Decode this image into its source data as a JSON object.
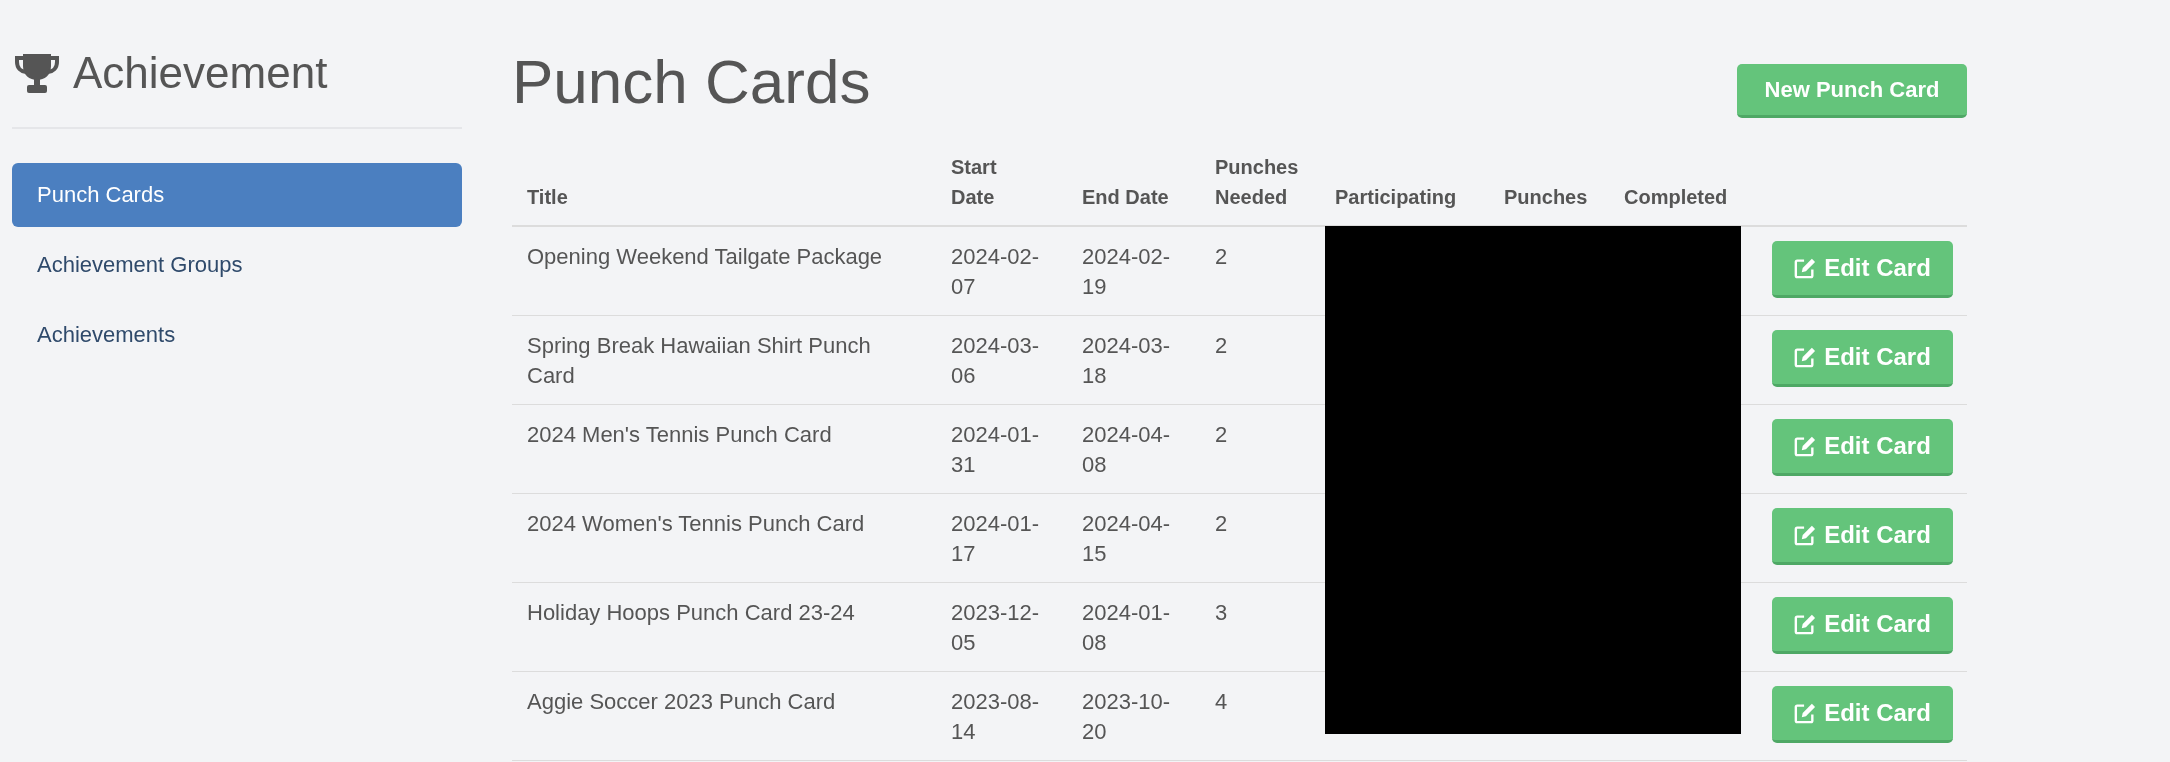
{
  "sidebar": {
    "title": "Achievement",
    "items": [
      {
        "label": "Punch Cards",
        "selected": true
      },
      {
        "label": "Achievement Groups",
        "selected": false
      },
      {
        "label": "Achievements",
        "selected": false
      }
    ]
  },
  "page": {
    "title": "Punch Cards",
    "new_button": "New Punch Card"
  },
  "table": {
    "columns": [
      "Title",
      "Start Date",
      "End Date",
      "Punches Needed",
      "Participating",
      "Punches",
      "Completed"
    ],
    "redacted": true,
    "rows": [
      {
        "title": "Opening Weekend Tailgate Package",
        "start_date": "2024-02-07",
        "end_date": "2024-02-19",
        "punches_needed": "2",
        "action": "Edit Card"
      },
      {
        "title": "Spring Break Hawaiian Shirt Punch Card",
        "start_date": "2024-03-06",
        "end_date": "2024-03-18",
        "punches_needed": "2",
        "action": "Edit Card"
      },
      {
        "title": "2024 Men's Tennis Punch Card",
        "start_date": "2024-01-31",
        "end_date": "2024-04-08",
        "punches_needed": "2",
        "action": "Edit Card"
      },
      {
        "title": "2024 Women's Tennis Punch Card",
        "start_date": "2024-01-17",
        "end_date": "2024-04-15",
        "punches_needed": "2",
        "action": "Edit Card"
      },
      {
        "title": "Holiday Hoops Punch Card 23-24",
        "start_date": "2023-12-05",
        "end_date": "2024-01-08",
        "punches_needed": "3",
        "action": "Edit Card"
      },
      {
        "title": "Aggie Soccer 2023 Punch Card",
        "start_date": "2023-08-14",
        "end_date": "2023-10-20",
        "punches_needed": "4",
        "action": "Edit Card"
      }
    ]
  }
}
